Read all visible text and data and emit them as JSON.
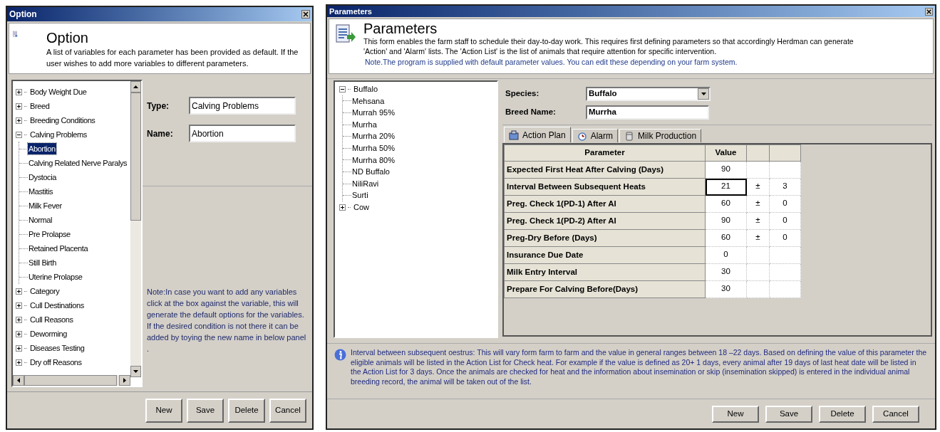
{
  "option_window": {
    "title": "Option",
    "header": {
      "title": "Option",
      "description": "A list of variables for each parameter has been provided as default.  If the user wishes to add more variables to different parameters."
    },
    "tree": [
      {
        "label": "Body Weight Due",
        "expanded": false,
        "selected": false
      },
      {
        "label": "Breed",
        "expanded": false,
        "selected": false
      },
      {
        "label": "Breeding Conditions",
        "expanded": false,
        "selected": false
      },
      {
        "label": "Calving Problems",
        "expanded": true,
        "selected": false,
        "children": [
          {
            "label": "Abortion",
            "selected": true
          },
          {
            "label": "Calving Related Nerve Paralys",
            "selected": false
          },
          {
            "label": "Dystocia",
            "selected": false
          },
          {
            "label": "Mastitis",
            "selected": false
          },
          {
            "label": "Milk Fever",
            "selected": false
          },
          {
            "label": "Normal",
            "selected": false
          },
          {
            "label": "Pre Prolapse",
            "selected": false
          },
          {
            "label": "Retained Placenta",
            "selected": false
          },
          {
            "label": "Still Birth",
            "selected": false
          },
          {
            "label": "Uterine Prolapse",
            "selected": false
          }
        ]
      },
      {
        "label": "Category",
        "expanded": false,
        "selected": false
      },
      {
        "label": "Cull Destinations",
        "expanded": false,
        "selected": false
      },
      {
        "label": "Cull Reasons",
        "expanded": false,
        "selected": false
      },
      {
        "label": "Deworming",
        "expanded": false,
        "selected": false
      },
      {
        "label": "Diseases Testing",
        "expanded": false,
        "selected": false
      },
      {
        "label": "Dry off Reasons",
        "expanded": false,
        "selected": false
      }
    ],
    "fields": [
      {
        "label": "Type:",
        "value": "Calving Problems"
      },
      {
        "label": "Name:",
        "value": "Abortion"
      }
    ],
    "note": "Note:In case you want to add any variables click at the box against the variable, this will generate the default options for the variables.  If the desired condition is not there it can be added by toying the new name in below panel  .",
    "buttons": [
      "New",
      "Save",
      "Delete",
      "Cancel"
    ]
  },
  "parameters_window": {
    "title": "Parameters",
    "header": {
      "title": "Parameters",
      "description": "This form enables the farm staff to schedule their day-to-day work.  This requires first defining parameters so that accordingly Herdman can generate 'Action' and 'Alarm' lists.  The 'Action List' is the list of animals that require attention for specific intervention.",
      "note": "Note.The program is supplied with default parameter values.  You can edit these depending on your farm system."
    },
    "tree": [
      {
        "label": "Buffalo",
        "expanded": true,
        "selected": false,
        "children": [
          {
            "label": "Mehsana",
            "selected": false
          },
          {
            "label": "Murrah 95%",
            "selected": false
          },
          {
            "label": "Murrha",
            "selected": false
          },
          {
            "label": "Murrha 20%",
            "selected": false
          },
          {
            "label": "Murrha 50%",
            "selected": false
          },
          {
            "label": "Murrha 80%",
            "selected": false
          },
          {
            "label": "ND Buffalo",
            "selected": false
          },
          {
            "label": "NiliRavi",
            "selected": false
          },
          {
            "label": "Surti",
            "selected": false
          }
        ]
      },
      {
        "label": "Cow",
        "expanded": false,
        "selected": false
      }
    ],
    "species": {
      "label": "Species:",
      "value": "Buffalo"
    },
    "breed_name": {
      "label": "Breed Name:",
      "value": "Murrha"
    },
    "tabs": [
      {
        "label": "Action Plan",
        "kind": "action",
        "selected": true
      },
      {
        "label": "Alarm",
        "kind": "alarm",
        "selected": false
      },
      {
        "label": "Milk Production",
        "kind": "milk",
        "selected": false
      }
    ],
    "table": {
      "columns": [
        "Parameter",
        "Value"
      ],
      "rows": [
        {
          "parameter": "Expected First Heat After Calving (Days)",
          "value": "90",
          "editing": false
        },
        {
          "parameter": "Interval Between Subsequent Heats",
          "value": "21",
          "plus_minus": "±",
          "tolerance": "3",
          "editing": true
        },
        {
          "parameter": "Preg. Check 1(PD-1) After AI",
          "value": "60",
          "plus_minus": "±",
          "tolerance": "0",
          "editing": false
        },
        {
          "parameter": "Preg. Check 1(PD-2) After AI",
          "value": "90",
          "plus_minus": "±",
          "tolerance": "0",
          "editing": false
        },
        {
          "parameter": "Preg-Dry Before (Days)",
          "value": "60",
          "plus_minus": "±",
          "tolerance": "0",
          "editing": false
        },
        {
          "parameter": "Insurance Due Date",
          "value": "0",
          "editing": false
        },
        {
          "parameter": "Milk Entry Interval",
          "value": "30",
          "editing": false
        },
        {
          "parameter": "Prepare For Calving Before(Days)",
          "value": "30",
          "editing": false
        }
      ]
    },
    "info": "Interval between subsequent oestrus: This will vary form farm to farm and the value in general ranges between 18 –22 days.  Based on defining the value of this parameter the eligible animals will be listed in the Action List for Check heat.  For example if the value is defined as 20+ 1 days, every animal after 19 days of last heat date will be listed in the Action List for 3 days.  Once the animals are checked for heat and the information about insemination or skip (insemination skipped) is entered in the individual animal breeding record, the animal will be taken out of the list.",
    "buttons": [
      "New",
      "Save",
      "Delete",
      "Cancel"
    ]
  }
}
